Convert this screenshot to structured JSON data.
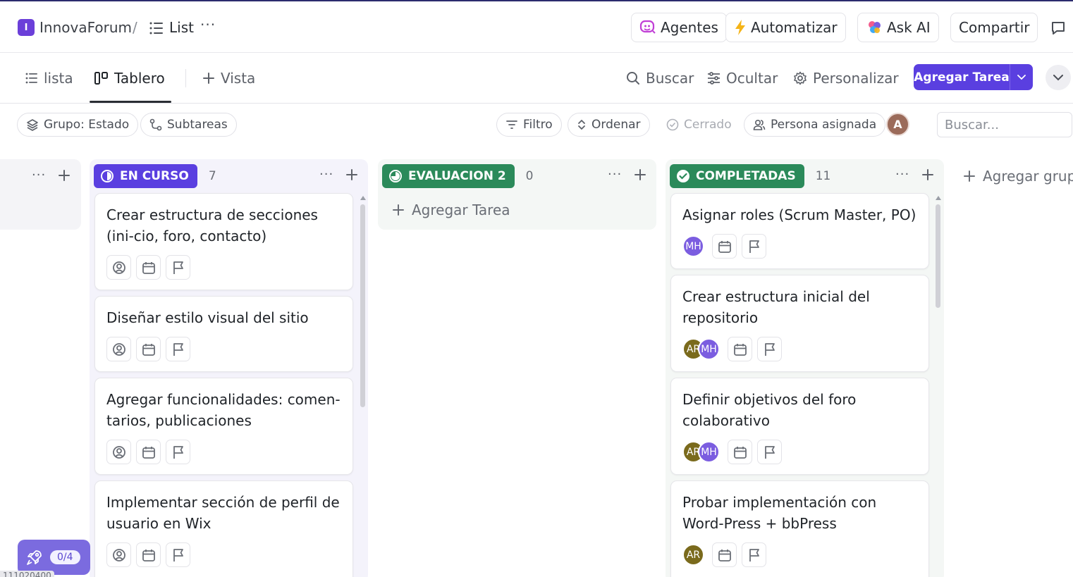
{
  "topbar": {
    "workspace_initial": "I",
    "workspace_name": "InnovaForum",
    "separator": "/",
    "list_label": "List",
    "more": "···",
    "agents_label": "Agentes",
    "automate_label": "Automatizar",
    "ask_ai_label": "Ask AI",
    "share_label": "Compartir"
  },
  "viewbar": {
    "tabs": [
      {
        "label": "lista",
        "icon": "list-icon"
      },
      {
        "label": "Tablero",
        "icon": "board-icon",
        "active": true
      }
    ],
    "add_view_label": "Vista",
    "search_label": "Buscar",
    "hide_label": "Ocultar",
    "customize_label": "Personalizar",
    "add_task_label": "Agregar Tarea"
  },
  "filterbar": {
    "group_label": "Grupo: Estado",
    "subtasks_label": "Subtareas",
    "filter_label": "Filtro",
    "sort_label": "Ordenar",
    "closed_label": "Cerrado",
    "assignee_label": "Persona asignada",
    "me_avatar": "A",
    "search_placeholder": "Buscar..."
  },
  "board": {
    "columns": [
      {
        "status": "EN CURSO",
        "count": "7",
        "color": "#5a3fe0",
        "cards": [
          {
            "title": "Crear estructura de secciones (ini-cio, foro, contacto)"
          },
          {
            "title": "Diseñar estilo visual del sitio"
          },
          {
            "title": "Agregar funcionalidades: comen-tarios, publicaciones"
          },
          {
            "title": "Implementar sección de perfil de usuario en Wix"
          }
        ]
      },
      {
        "status": "EVALUACION 2",
        "count": "0",
        "color": "#2b8a5a",
        "add_task_label": "Agregar Tarea",
        "cards": []
      },
      {
        "status": "COMPLETADAS",
        "count": "11",
        "color": "#2b8a5a",
        "cards": [
          {
            "title": "Asignar roles (Scrum Master, PO)",
            "assignees": [
              "MH"
            ]
          },
          {
            "title": "Crear estructura inicial del repositorio",
            "assignees": [
              "AR",
              "MH"
            ]
          },
          {
            "title": "Definir objetivos del foro colaborativo",
            "assignees": [
              "AR",
              "MH"
            ]
          },
          {
            "title": "Probar implementación con Word-Press + bbPress",
            "assignees": [
              "AR"
            ]
          }
        ]
      }
    ],
    "add_group_label": "Agregar grupo"
  },
  "onboarding": {
    "progress": "0/4"
  },
  "footer_text": "111020400"
}
